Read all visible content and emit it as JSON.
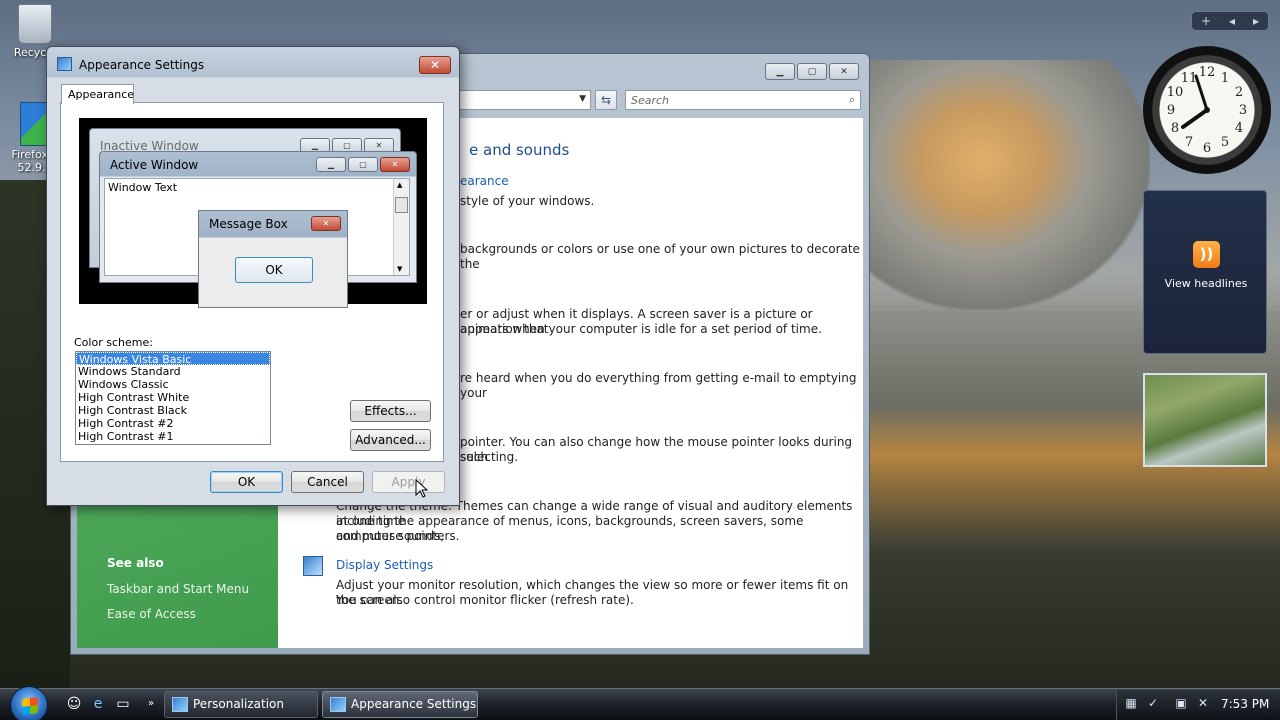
{
  "desktop": {
    "icons": [
      {
        "label": "Recycle"
      },
      {
        "label": "Firefox S",
        "label2": "52.9.0"
      }
    ]
  },
  "personalization": {
    "search_placeholder": "Search",
    "heading": "e and sounds",
    "sections": [
      {
        "link": "earance",
        "desc": "style of your windows."
      },
      {
        "desc": "backgrounds or colors or use one of your own pictures to decorate the"
      },
      {
        "desc": "er or adjust when it displays. A screen saver is a picture or animation that",
        "desc2": "appears when your computer is idle for a set period of time."
      },
      {
        "desc": "re heard when you do everything from getting e-mail to emptying your"
      },
      {
        "desc": "pointer. You can also change how the mouse pointer looks during such",
        "desc2": "selecting."
      },
      {
        "desc": "Change the theme. Themes can change a wide range of visual and auditory elements at one time",
        "desc2": "including the appearance of menus, icons, backgrounds, screen savers, some computer sounds,",
        "desc3": "and mouse pointers."
      },
      {
        "link": "Display Settings",
        "desc": "Adjust your monitor resolution, which changes the view so more or fewer items fit on the screen.",
        "desc2": "You can also control monitor flicker (refresh rate)."
      }
    ],
    "see_also": "See also",
    "see_also_links": [
      "Taskbar and Start Menu",
      "Ease of Access"
    ]
  },
  "dialog": {
    "title": "Appearance Settings",
    "tab": "Appearance",
    "preview": {
      "inactive_title": "Inactive Window",
      "active_title": "Active Window",
      "window_text": "Window Text",
      "message_title": "Message Box",
      "message_ok": "OK"
    },
    "color_scheme_label": "Color scheme:",
    "color_schemes": [
      "Windows Vista Basic",
      "Windows Standard",
      "Windows Classic",
      "High Contrast White",
      "High Contrast Black",
      "High Contrast #2",
      "High Contrast #1"
    ],
    "selected_scheme": "Windows Vista Basic",
    "effects_label": "Effects...",
    "advanced_label": "Advanced...",
    "ok_label": "OK",
    "cancel_label": "Cancel",
    "apply_label": "Apply"
  },
  "gadgets": {
    "feed_label": "View headlines"
  },
  "taskbar": {
    "buttons": [
      {
        "label": "Personalization"
      },
      {
        "label": "Appearance Settings"
      }
    ],
    "clock": "7:53 PM"
  },
  "colors": {
    "accent": "#3b86e0",
    "link": "#1a5fb4",
    "heading": "#1c4f8d",
    "sidebar_green": "#4ea85a"
  }
}
